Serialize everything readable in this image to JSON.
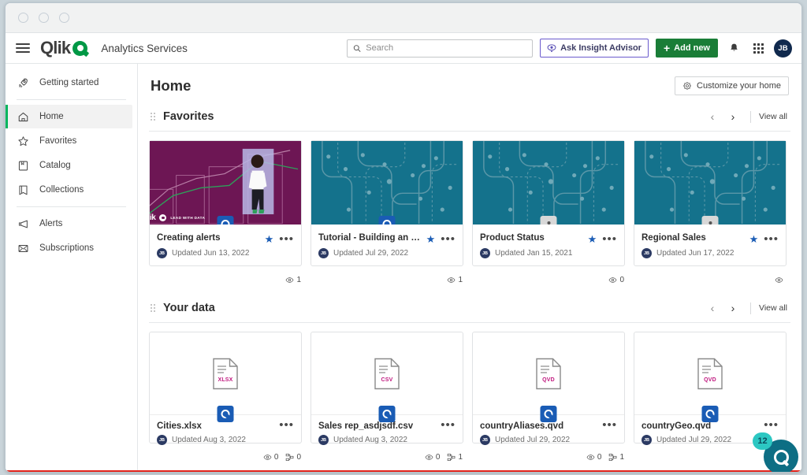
{
  "window": {
    "dots": [
      "close",
      "minimize",
      "maximize"
    ]
  },
  "header": {
    "menu_icon": "hamburger-icon",
    "logo_text": "Qlik",
    "tenant": "Analytics Services",
    "search": {
      "placeholder": "Search",
      "value": "",
      "icon": "search-icon"
    },
    "insight_advisor": {
      "label": "Ask Insight Advisor",
      "icon": "insight-advisor-icon",
      "border_color": "#6a5acd"
    },
    "add_new": {
      "label": "Add new",
      "icon": "plus-icon",
      "color": "#1a7d37"
    },
    "notifications_icon": "bell-icon",
    "apps_icon": "app-grid-icon",
    "avatar_initials": "JB",
    "avatar_color": "#10294d"
  },
  "sidebar": {
    "items": [
      {
        "label": "Getting started",
        "icon": "rocket-icon",
        "active": false
      },
      {
        "label": "Home",
        "icon": "home-icon",
        "active": true
      },
      {
        "label": "Favorites",
        "icon": "star-icon",
        "active": false
      },
      {
        "label": "Catalog",
        "icon": "catalog-icon",
        "active": false
      },
      {
        "label": "Collections",
        "icon": "collections-icon",
        "active": false
      },
      {
        "label": "Alerts",
        "icon": "megaphone-icon",
        "active": false
      },
      {
        "label": "Subscriptions",
        "icon": "envelope-icon",
        "active": false
      }
    ],
    "active_accent": "#00b55e"
  },
  "page": {
    "title": "Home",
    "customize_button": {
      "label": "Customize your home",
      "icon": "gear-icon"
    }
  },
  "sections": [
    {
      "title": "Favorites",
      "prev_label": "‹",
      "next_label": "›",
      "view_all": "View all",
      "cards": [
        {
          "title": "Creating alerts",
          "date": "Updated Jun 13, 2022",
          "avatar_initials": "JB",
          "thumb_style": "magenta",
          "thumb_color": "#6d1654",
          "badge": "app",
          "badge_color": "#1a5cb5",
          "favorited": true,
          "star_color": "#1a5cb5",
          "views": "1",
          "strip_logo": "ik",
          "strip_tag": "LEAD WITH DATA"
        },
        {
          "title": "Tutorial - Building an analytics …",
          "date": "Updated Jul 29, 2022",
          "avatar_initials": "JB",
          "thumb_style": "teal",
          "thumb_color": "#14728c",
          "badge": "app",
          "badge_color": "#1a5cb5",
          "favorited": true,
          "star_color": "#1a5cb5",
          "views": "1"
        },
        {
          "title": "Product Status",
          "date": "Updated Jan 15, 2021",
          "avatar_initials": "JB",
          "thumb_style": "teal",
          "thumb_color": "#14728c",
          "badge": "shared",
          "badge_color": "#d8d8d8",
          "favorited": true,
          "star_color": "#1a5cb5",
          "views": "0"
        },
        {
          "title": "Regional Sales",
          "date": "Updated Jun 17, 2022",
          "avatar_initials": "JB",
          "thumb_style": "teal",
          "thumb_color": "#14728c",
          "badge": "shared",
          "badge_color": "#d8d8d8",
          "favorited": true,
          "star_color": "#1a5cb5",
          "views": ""
        }
      ]
    },
    {
      "title": "Your data",
      "prev_label": "‹",
      "next_label": "›",
      "view_all": "View all",
      "cards": [
        {
          "title": "Cities.xlsx",
          "date": "Updated Aug 3, 2022",
          "avatar_initials": "JB",
          "file_ext": "XLSX",
          "ext_color": "#c0187f",
          "badge": "app",
          "badge_color": "#1a5cb5",
          "views": "0",
          "links": "0"
        },
        {
          "title": "Sales rep_asdjsdf.csv",
          "date": "Updated Aug 3, 2022",
          "avatar_initials": "JB",
          "file_ext": "CSV",
          "ext_color": "#c0187f",
          "badge": "app",
          "badge_color": "#1a5cb5",
          "views": "0",
          "links": "1"
        },
        {
          "title": "countryAliases.qvd",
          "date": "Updated Jul 29, 2022",
          "avatar_initials": "JB",
          "file_ext": "QVD",
          "ext_color": "#c0187f",
          "badge": "app",
          "badge_color": "#1a5cb5",
          "views": "0",
          "links": "1"
        },
        {
          "title": "countryGeo.qvd",
          "date": "Updated Jul 29, 2022",
          "avatar_initials": "JB",
          "file_ext": "QVD",
          "ext_color": "#c0187f",
          "badge": "app",
          "badge_color": "#1a5cb5",
          "views": "",
          "links": ""
        }
      ]
    }
  ],
  "help_widget": {
    "count": "12",
    "icon": "qlik-help-icon",
    "badge_color": "#2cc7c2",
    "button_color": "#0d6e84"
  },
  "kebab_label": "•••",
  "star_glyph": "★"
}
